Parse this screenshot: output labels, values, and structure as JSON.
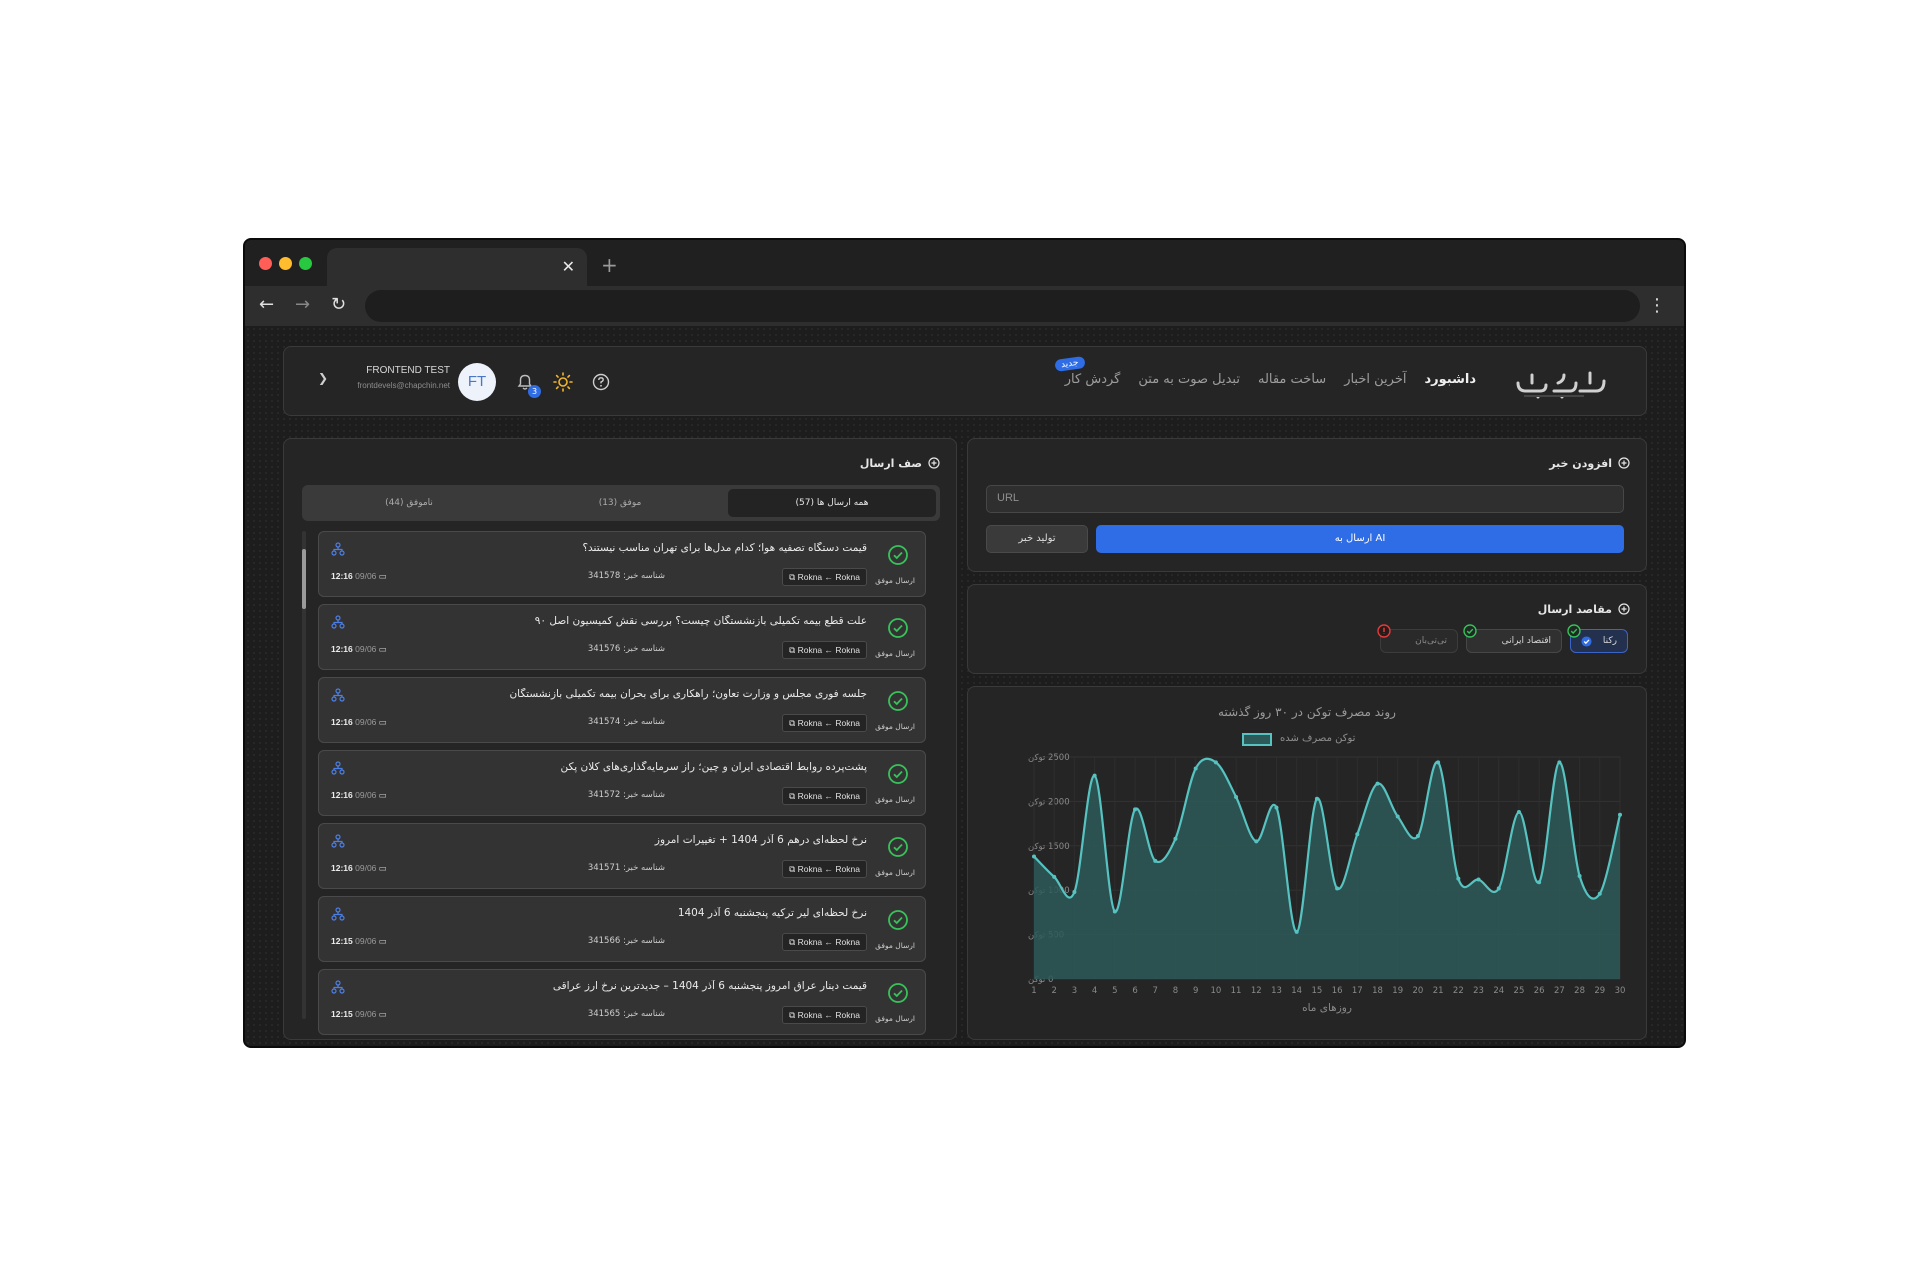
{
  "header": {
    "logo_alt": "چاپچین",
    "nav": [
      "داشبورد",
      "آخرین اخبار",
      "ساخت مقاله",
      "تبدیل صوت به متن",
      "گردش کار"
    ],
    "new_badge": "جدید",
    "user_name": "FRONTEND TEST",
    "user_email": "frontdevels@chapchin.net",
    "avatar": "FT",
    "notification_count": "3"
  },
  "add_news": {
    "title": "افزودن خبر",
    "url_placeholder": "URL",
    "send_ai": "ارسال به AI",
    "generate": "تولید خبر"
  },
  "destinations": {
    "title": "مقاصد ارسال",
    "items": [
      {
        "label": "رکنا",
        "state": "selected"
      },
      {
        "label": "اقتصاد ایرانی",
        "state": "ok"
      },
      {
        "label": "تی‌تی‌بان",
        "state": "error"
      }
    ]
  },
  "queue": {
    "title": "صف ارسال",
    "tabs": [
      "همه ارسال ها (57)",
      "موفق (13)",
      "ناموفق (44)"
    ],
    "ok_label": "ارسال موفق",
    "id_label": "شناسه خبر:",
    "items": [
      {
        "title": "قیمت دستگاه تصفیه هوا؛ کدام مدل‌ها برای تهران مناسب نیستند؟",
        "src": "Rokna",
        "dst": "Rokna",
        "id": "341578",
        "time": "12:16",
        "date": "09/06"
      },
      {
        "title": "علت قطع بیمه تکمیلی بازنشستگان چیست؟ بررسی نقش کمیسیون اصل ۹۰",
        "src": "Rokna",
        "dst": "Rokna",
        "id": "341576",
        "time": "12:16",
        "date": "09/06"
      },
      {
        "title": "جلسه فوری مجلس و وزارت تعاون؛ راهکاری برای بحران بیمه تکمیلی بازنشستگان",
        "src": "Rokna",
        "dst": "Rokna",
        "id": "341574",
        "time": "12:16",
        "date": "09/06"
      },
      {
        "title": "پشت‌پرده روابط اقتصادی ایران و چین؛ راز سرمایه‌گذاری‌های کلان پکن",
        "src": "Rokna",
        "dst": "Rokna",
        "id": "341572",
        "time": "12:16",
        "date": "09/06"
      },
      {
        "title": "نرخ لحظه‌ای درهم 6 آذر 1404 + تغییرات امروز",
        "src": "Rokna",
        "dst": "Rokna",
        "id": "341571",
        "time": "12:16",
        "date": "09/06"
      },
      {
        "title": "نرخ لحظه‌ای لیر ترکیه پنجشنبه 6 آذر 1404",
        "src": "Rokna",
        "dst": "Rokna",
        "id": "341566",
        "time": "12:15",
        "date": "09/06"
      },
      {
        "title": "قیمت دینار عراق امروز پنجشنبه 6 آذر 1404 – جدیدترین نرخ ارز عراقی",
        "src": "Rokna",
        "dst": "Rokna",
        "id": "341565",
        "time": "12:15",
        "date": "09/06"
      }
    ]
  },
  "chart_data": {
    "type": "area",
    "title": "روند مصرف توکن در ۳۰ روز گذشته",
    "series": [
      {
        "name": "توکن مصرف شده",
        "values": [
          1380,
          1150,
          980,
          2290,
          760,
          1910,
          1330,
          1580,
          2370,
          2440,
          2050,
          1550,
          1930,
          530,
          2030,
          1020,
          1630,
          2200,
          1830,
          1610,
          2440,
          1130,
          1120,
          1020,
          1880,
          1090,
          2440,
          1160,
          960,
          1850
        ]
      }
    ],
    "x": [
      1,
      2,
      3,
      4,
      5,
      6,
      7,
      8,
      9,
      10,
      11,
      12,
      13,
      14,
      15,
      16,
      17,
      18,
      19,
      20,
      21,
      22,
      23,
      24,
      25,
      26,
      27,
      28,
      29,
      30
    ],
    "xlabel": "روزهای ماه",
    "ylabel": "",
    "y_ticks": [
      "0 توکن",
      "500 توکن",
      "1000 توکن",
      "1500 توکن",
      "2000 توکن",
      "2500 توکن"
    ],
    "ylim": [
      0,
      2500
    ],
    "colors": {
      "line": "#56c3c1",
      "fill": "#2d5958"
    }
  }
}
